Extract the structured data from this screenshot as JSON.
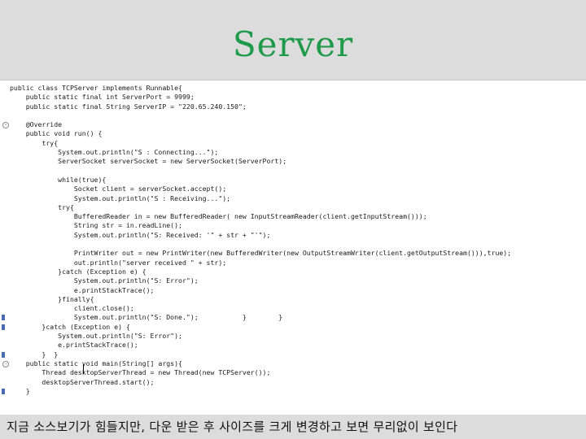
{
  "slide": {
    "title": "Server",
    "caption": "지금 소스보기가 힘들지만, 다운 받은 후 사이즈를 크게 변경하고 보면 무리없이 보인다"
  },
  "code": {
    "lines": [
      "public class TCPServer implements Runnable{",
      "    public static final int ServerPort = 9999;",
      "    public static final String ServerIP = \"220.65.240.150\";",
      "",
      "    @Override",
      "    public void run() {",
      "        try{",
      "            System.out.println(\"S : Connecting...\");",
      "            ServerSocket serverSocket = new ServerSocket(ServerPort);",
      "",
      "            while(true){",
      "                Socket client = serverSocket.accept();",
      "                System.out.println(\"S : Receiving...\");",
      "            try{",
      "                BufferedReader in = new BufferedReader( new InputStreamReader(client.getInputStream()));",
      "                String str = in.readLine();",
      "                System.out.println(\"S: Received: '\" + str + \"'\");",
      "",
      "                PrintWriter out = new PrintWriter(new BufferedWriter(new OutputStreamWriter(client.getOutputStream())),true);",
      "                out.println(\"server received \" + str);",
      "            }catch (Exception e) {",
      "                System.out.println(\"S: Error\");",
      "                e.printStackTrace();",
      "            }finally{",
      "                client.close();",
      "                System.out.println(\"S: Done.\");           }        }",
      "        }catch (Exception e) {",
      "            System.out.println(\"S: Error\");",
      "            e.printStackTrace();",
      "        }  }",
      "    public static void main(String[] args){",
      "        Thread desktopServerThread = new Thread(new TCPServer());",
      "        desktopServerThread.start();",
      "    }"
    ]
  }
}
